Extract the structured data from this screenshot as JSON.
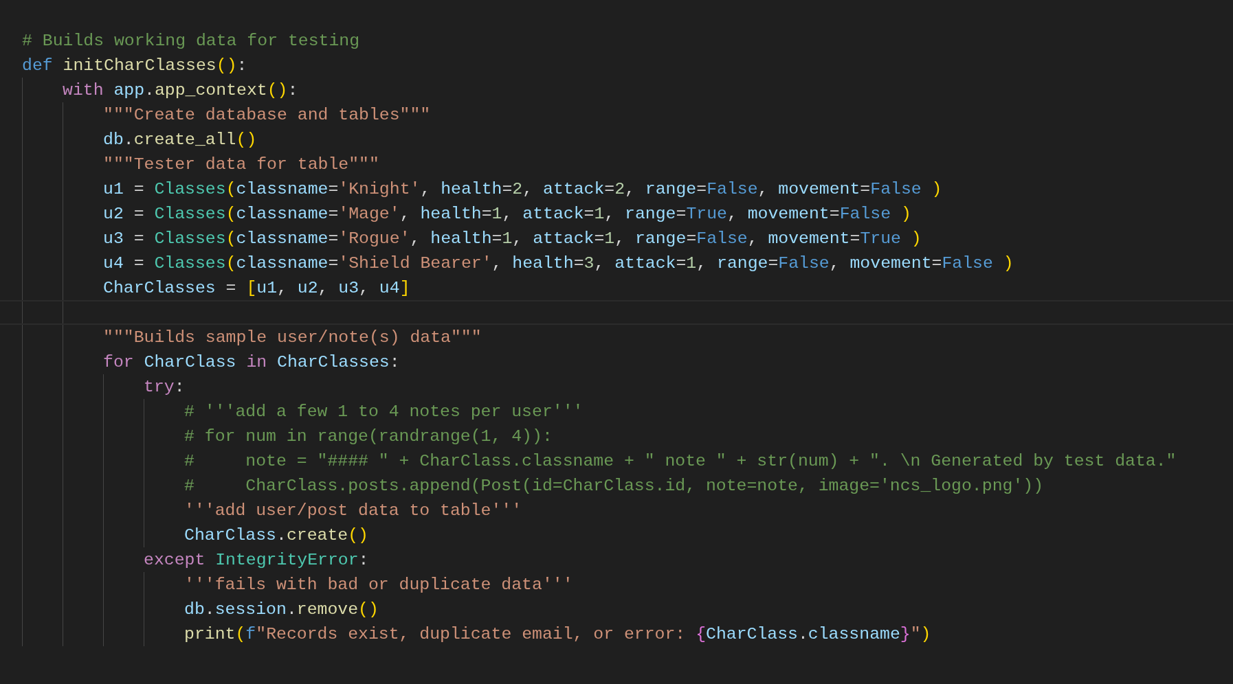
{
  "editor": {
    "lines": [
      {
        "current": false,
        "tokens": [
          {
            "text": "# Builds working data for testing",
            "kind": "comment"
          }
        ]
      },
      {
        "current": false,
        "tokens": [
          {
            "text": "def ",
            "kind": "keyword"
          },
          {
            "text": "initCharClasses",
            "kind": "function"
          },
          {
            "text": "()",
            "kind": "bracket"
          },
          {
            "text": ":",
            "kind": "plain"
          }
        ],
        "children": [
          {
            "current": false,
            "tokens": [
              {
                "text": "with ",
                "kind": "control"
              },
              {
                "text": "app",
                "kind": "variable"
              },
              {
                "text": ".",
                "kind": "plain"
              },
              {
                "text": "app_context",
                "kind": "function"
              },
              {
                "text": "()",
                "kind": "bracket"
              },
              {
                "text": ":",
                "kind": "plain"
              }
            ],
            "children": [
              {
                "current": false,
                "tokens": [
                  {
                    "text": "\"\"\"Create database and tables\"\"\"",
                    "kind": "string"
                  }
                ]
              },
              {
                "current": false,
                "tokens": [
                  {
                    "text": "db",
                    "kind": "variable"
                  },
                  {
                    "text": ".",
                    "kind": "plain"
                  },
                  {
                    "text": "create_all",
                    "kind": "function"
                  },
                  {
                    "text": "()",
                    "kind": "bracket"
                  }
                ]
              },
              {
                "current": false,
                "tokens": [
                  {
                    "text": "\"\"\"Tester data for table\"\"\"",
                    "kind": "string"
                  }
                ]
              },
              {
                "current": false,
                "tokens": [
                  {
                    "text": "u1",
                    "kind": "variable"
                  },
                  {
                    "text": " = ",
                    "kind": "plain"
                  },
                  {
                    "text": "Classes",
                    "kind": "class"
                  },
                  {
                    "text": "(",
                    "kind": "bracket"
                  },
                  {
                    "text": "classname",
                    "kind": "variable"
                  },
                  {
                    "text": "=",
                    "kind": "plain"
                  },
                  {
                    "text": "'Knight'",
                    "kind": "string"
                  },
                  {
                    "text": ", ",
                    "kind": "plain"
                  },
                  {
                    "text": "health",
                    "kind": "variable"
                  },
                  {
                    "text": "=",
                    "kind": "plain"
                  },
                  {
                    "text": "2",
                    "kind": "number"
                  },
                  {
                    "text": ", ",
                    "kind": "plain"
                  },
                  {
                    "text": "attack",
                    "kind": "variable"
                  },
                  {
                    "text": "=",
                    "kind": "plain"
                  },
                  {
                    "text": "2",
                    "kind": "number"
                  },
                  {
                    "text": ", ",
                    "kind": "plain"
                  },
                  {
                    "text": "range",
                    "kind": "variable"
                  },
                  {
                    "text": "=",
                    "kind": "plain"
                  },
                  {
                    "text": "False",
                    "kind": "constant"
                  },
                  {
                    "text": ", ",
                    "kind": "plain"
                  },
                  {
                    "text": "movement",
                    "kind": "variable"
                  },
                  {
                    "text": "=",
                    "kind": "plain"
                  },
                  {
                    "text": "False",
                    "kind": "constant"
                  },
                  {
                    "text": " )",
                    "kind": "bracket"
                  }
                ]
              },
              {
                "current": false,
                "tokens": [
                  {
                    "text": "u2",
                    "kind": "variable"
                  },
                  {
                    "text": " = ",
                    "kind": "plain"
                  },
                  {
                    "text": "Classes",
                    "kind": "class"
                  },
                  {
                    "text": "(",
                    "kind": "bracket"
                  },
                  {
                    "text": "classname",
                    "kind": "variable"
                  },
                  {
                    "text": "=",
                    "kind": "plain"
                  },
                  {
                    "text": "'Mage'",
                    "kind": "string"
                  },
                  {
                    "text": ", ",
                    "kind": "plain"
                  },
                  {
                    "text": "health",
                    "kind": "variable"
                  },
                  {
                    "text": "=",
                    "kind": "plain"
                  },
                  {
                    "text": "1",
                    "kind": "number"
                  },
                  {
                    "text": ", ",
                    "kind": "plain"
                  },
                  {
                    "text": "attack",
                    "kind": "variable"
                  },
                  {
                    "text": "=",
                    "kind": "plain"
                  },
                  {
                    "text": "1",
                    "kind": "number"
                  },
                  {
                    "text": ", ",
                    "kind": "plain"
                  },
                  {
                    "text": "range",
                    "kind": "variable"
                  },
                  {
                    "text": "=",
                    "kind": "plain"
                  },
                  {
                    "text": "True",
                    "kind": "constant"
                  },
                  {
                    "text": ", ",
                    "kind": "plain"
                  },
                  {
                    "text": "movement",
                    "kind": "variable"
                  },
                  {
                    "text": "=",
                    "kind": "plain"
                  },
                  {
                    "text": "False",
                    "kind": "constant"
                  },
                  {
                    "text": " )",
                    "kind": "bracket"
                  }
                ]
              },
              {
                "current": false,
                "tokens": [
                  {
                    "text": "u3",
                    "kind": "variable"
                  },
                  {
                    "text": " = ",
                    "kind": "plain"
                  },
                  {
                    "text": "Classes",
                    "kind": "class"
                  },
                  {
                    "text": "(",
                    "kind": "bracket"
                  },
                  {
                    "text": "classname",
                    "kind": "variable"
                  },
                  {
                    "text": "=",
                    "kind": "plain"
                  },
                  {
                    "text": "'Rogue'",
                    "kind": "string"
                  },
                  {
                    "text": ", ",
                    "kind": "plain"
                  },
                  {
                    "text": "health",
                    "kind": "variable"
                  },
                  {
                    "text": "=",
                    "kind": "plain"
                  },
                  {
                    "text": "1",
                    "kind": "number"
                  },
                  {
                    "text": ", ",
                    "kind": "plain"
                  },
                  {
                    "text": "attack",
                    "kind": "variable"
                  },
                  {
                    "text": "=",
                    "kind": "plain"
                  },
                  {
                    "text": "1",
                    "kind": "number"
                  },
                  {
                    "text": ", ",
                    "kind": "plain"
                  },
                  {
                    "text": "range",
                    "kind": "variable"
                  },
                  {
                    "text": "=",
                    "kind": "plain"
                  },
                  {
                    "text": "False",
                    "kind": "constant"
                  },
                  {
                    "text": ", ",
                    "kind": "plain"
                  },
                  {
                    "text": "movement",
                    "kind": "variable"
                  },
                  {
                    "text": "=",
                    "kind": "plain"
                  },
                  {
                    "text": "True",
                    "kind": "constant"
                  },
                  {
                    "text": " )",
                    "kind": "bracket"
                  }
                ]
              },
              {
                "current": false,
                "tokens": [
                  {
                    "text": "u4",
                    "kind": "variable"
                  },
                  {
                    "text": " = ",
                    "kind": "plain"
                  },
                  {
                    "text": "Classes",
                    "kind": "class"
                  },
                  {
                    "text": "(",
                    "kind": "bracket"
                  },
                  {
                    "text": "classname",
                    "kind": "variable"
                  },
                  {
                    "text": "=",
                    "kind": "plain"
                  },
                  {
                    "text": "'Shield Bearer'",
                    "kind": "string"
                  },
                  {
                    "text": ", ",
                    "kind": "plain"
                  },
                  {
                    "text": "health",
                    "kind": "variable"
                  },
                  {
                    "text": "=",
                    "kind": "plain"
                  },
                  {
                    "text": "3",
                    "kind": "number"
                  },
                  {
                    "text": ", ",
                    "kind": "plain"
                  },
                  {
                    "text": "attack",
                    "kind": "variable"
                  },
                  {
                    "text": "=",
                    "kind": "plain"
                  },
                  {
                    "text": "1",
                    "kind": "number"
                  },
                  {
                    "text": ", ",
                    "kind": "plain"
                  },
                  {
                    "text": "range",
                    "kind": "variable"
                  },
                  {
                    "text": "=",
                    "kind": "plain"
                  },
                  {
                    "text": "False",
                    "kind": "constant"
                  },
                  {
                    "text": ", ",
                    "kind": "plain"
                  },
                  {
                    "text": "movement",
                    "kind": "variable"
                  },
                  {
                    "text": "=",
                    "kind": "plain"
                  },
                  {
                    "text": "False",
                    "kind": "constant"
                  },
                  {
                    "text": " )",
                    "kind": "bracket"
                  }
                ]
              },
              {
                "current": false,
                "tokens": [
                  {
                    "text": "CharClasses",
                    "kind": "variable"
                  },
                  {
                    "text": " = ",
                    "kind": "plain"
                  },
                  {
                    "text": "[",
                    "kind": "bracket"
                  },
                  {
                    "text": "u1",
                    "kind": "variable"
                  },
                  {
                    "text": ", ",
                    "kind": "plain"
                  },
                  {
                    "text": "u2",
                    "kind": "variable"
                  },
                  {
                    "text": ", ",
                    "kind": "plain"
                  },
                  {
                    "text": "u3",
                    "kind": "variable"
                  },
                  {
                    "text": ", ",
                    "kind": "plain"
                  },
                  {
                    "text": "u4",
                    "kind": "variable"
                  },
                  {
                    "text": "]",
                    "kind": "bracket"
                  }
                ]
              },
              {
                "current": true
              },
              {
                "current": false,
                "tokens": [
                  {
                    "text": "\"\"\"Builds sample user/note(s) data\"\"\"",
                    "kind": "string"
                  }
                ]
              },
              {
                "current": false,
                "tokens": [
                  {
                    "text": "for ",
                    "kind": "control"
                  },
                  {
                    "text": "CharClass",
                    "kind": "variable"
                  },
                  {
                    "text": " in ",
                    "kind": "control"
                  },
                  {
                    "text": "CharClasses",
                    "kind": "variable"
                  },
                  {
                    "text": ":",
                    "kind": "plain"
                  }
                ],
                "children": [
                  {
                    "current": false,
                    "tokens": [
                      {
                        "text": "try",
                        "kind": "control"
                      },
                      {
                        "text": ":",
                        "kind": "plain"
                      }
                    ],
                    "children": [
                      {
                        "current": false,
                        "tokens": [
                          {
                            "text": "# '''add a few 1 to 4 notes per user'''",
                            "kind": "comment"
                          }
                        ]
                      },
                      {
                        "current": false,
                        "tokens": [
                          {
                            "text": "# for num in range(randrange(1, 4)):",
                            "kind": "comment"
                          }
                        ]
                      },
                      {
                        "current": false,
                        "tokens": [
                          {
                            "text": "#     note = \"#### \" + CharClass.classname + \" note \" + str(num) + \". \\n Generated by test data.\"",
                            "kind": "comment"
                          }
                        ]
                      },
                      {
                        "current": false,
                        "tokens": [
                          {
                            "text": "#     CharClass.posts.append(Post(id=CharClass.id, note=note, image='ncs_logo.png'))",
                            "kind": "comment"
                          }
                        ]
                      },
                      {
                        "current": false,
                        "tokens": [
                          {
                            "text": "'''add user/post data to table'''",
                            "kind": "string"
                          }
                        ]
                      },
                      {
                        "current": false,
                        "tokens": [
                          {
                            "text": "CharClass",
                            "kind": "variable"
                          },
                          {
                            "text": ".",
                            "kind": "plain"
                          },
                          {
                            "text": "create",
                            "kind": "function"
                          },
                          {
                            "text": "()",
                            "kind": "bracket"
                          }
                        ]
                      }
                    ]
                  },
                  {
                    "current": false,
                    "tokens": [
                      {
                        "text": "except ",
                        "kind": "control"
                      },
                      {
                        "text": "IntegrityError",
                        "kind": "class"
                      },
                      {
                        "text": ":",
                        "kind": "plain"
                      }
                    ],
                    "children": [
                      {
                        "current": false,
                        "tokens": [
                          {
                            "text": "'''fails with bad or duplicate data'''",
                            "kind": "string"
                          }
                        ]
                      },
                      {
                        "current": false,
                        "tokens": [
                          {
                            "text": "db",
                            "kind": "variable"
                          },
                          {
                            "text": ".",
                            "kind": "plain"
                          },
                          {
                            "text": "session",
                            "kind": "variable"
                          },
                          {
                            "text": ".",
                            "kind": "plain"
                          },
                          {
                            "text": "remove",
                            "kind": "function"
                          },
                          {
                            "text": "()",
                            "kind": "bracket"
                          }
                        ]
                      },
                      {
                        "current": false,
                        "tokens": [
                          {
                            "text": "print",
                            "kind": "function"
                          },
                          {
                            "text": "(",
                            "kind": "bracket"
                          },
                          {
                            "text": "f",
                            "kind": "keyword"
                          },
                          {
                            "text": "\"Records exist, duplicate email, or error: ",
                            "kind": "string"
                          },
                          {
                            "text": "{",
                            "kind": "brace"
                          },
                          {
                            "text": "CharClass",
                            "kind": "variable"
                          },
                          {
                            "text": ".",
                            "kind": "plain"
                          },
                          {
                            "text": "classname",
                            "kind": "variable"
                          },
                          {
                            "text": "}",
                            "kind": "brace"
                          },
                          {
                            "text": "\"",
                            "kind": "string"
                          },
                          {
                            "text": ")",
                            "kind": "bracket"
                          }
                        ]
                      }
                    ]
                  }
                ]
              }
            ]
          }
        ]
      }
    ]
  }
}
